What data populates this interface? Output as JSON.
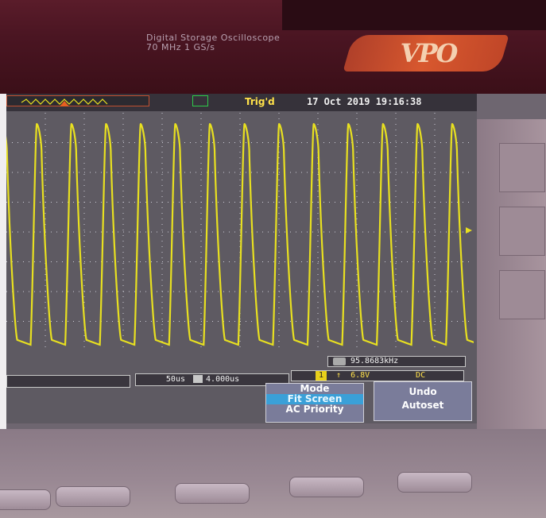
{
  "header": {
    "product_name": "Digital Storage Oscilloscope",
    "spec": "70 MHz  1 GS/s",
    "logo": "VPO"
  },
  "status_bar": {
    "trigger_status": "Trig'd",
    "datetime": "17 Oct 2019 19:16:38"
  },
  "measurements": {
    "frequency": "95.8683kHz",
    "timebase": "50us",
    "horizontal_position": "4.000us",
    "trigger_channel": "1",
    "trigger_slope_icon": "rising-edge-icon",
    "trigger_level": "6.8V",
    "coupling": "DC"
  },
  "menu": {
    "mode_title": "Mode",
    "mode_option_1": "Fit Screen",
    "mode_option_2": "AC Priority",
    "undo_title": "Undo",
    "undo_sub": "Autoset"
  },
  "waveform": {
    "color": "#e8e020",
    "shape": "sawtooth",
    "cycles_visible": 13.5
  },
  "colors": {
    "trace": "#e8e020",
    "trig_icon": "#2ecc4a",
    "highlight": "#3aa0d8"
  }
}
